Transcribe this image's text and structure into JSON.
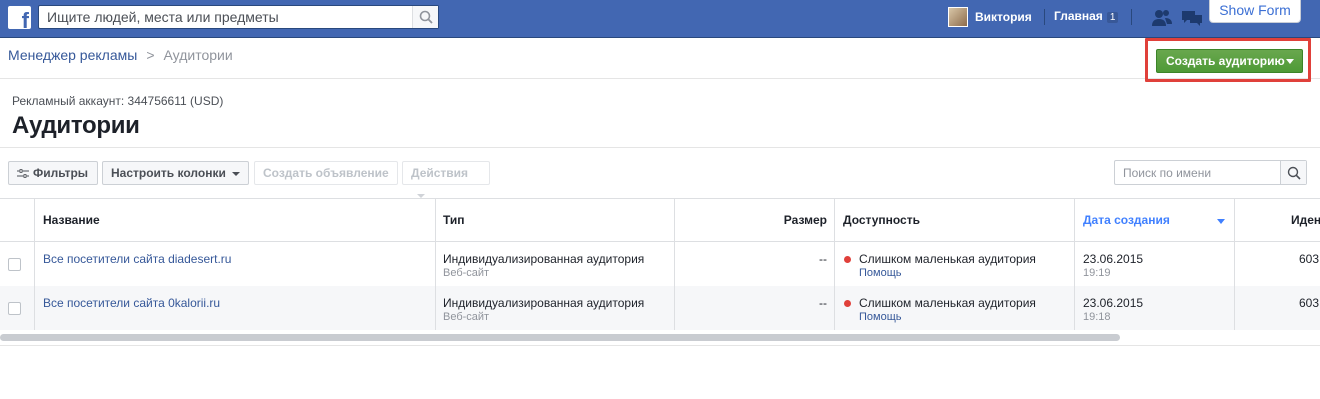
{
  "topbar": {
    "logo_icon": "facebook-logo-icon",
    "search_placeholder": "Ищите людей, места или предметы",
    "profile_name": "Виктория",
    "home_label": "Главная",
    "home_count": "1",
    "show_form_label": "Show Form",
    "brand_color": "#4267b2"
  },
  "breadcrumb": {
    "parent": "Менеджер рекламы",
    "separator": ">",
    "current": "Аудитории"
  },
  "create_button": {
    "label": "Создать аудиторию",
    "color": "#4e9a36",
    "highlight_color": "#e0403a"
  },
  "header": {
    "account": "Рекламный аккаунт: 344756611 (USD)",
    "title": "Аудитории"
  },
  "toolbar": {
    "filters": "Фильтры",
    "columns": "Настроить колонки",
    "create_ad": "Создать объявление",
    "actions": "Действия",
    "search_placeholder": "Поиск по имени"
  },
  "table": {
    "headers": {
      "name": "Название",
      "type": "Тип",
      "size": "Размер",
      "availability": "Доступность",
      "created": "Дата создания",
      "id": "Иден"
    },
    "rows": [
      {
        "name": "Все посетители сайта diadesert.ru",
        "type": "Индивидуализированная аудитория",
        "type_sub": "Веб-сайт",
        "size": "--",
        "availability": "Слишком маленькая аудитория",
        "help": "Помощь",
        "date": "23.06.2015",
        "time": "19:19",
        "id": "603"
      },
      {
        "name": "Все посетители сайта 0kalorii.ru",
        "type": "Индивидуализированная аудитория",
        "type_sub": "Веб-сайт",
        "size": "--",
        "availability": "Слишком маленькая аудитория",
        "help": "Помощь",
        "date": "23.06.2015",
        "time": "19:18",
        "id": "603"
      }
    ]
  }
}
